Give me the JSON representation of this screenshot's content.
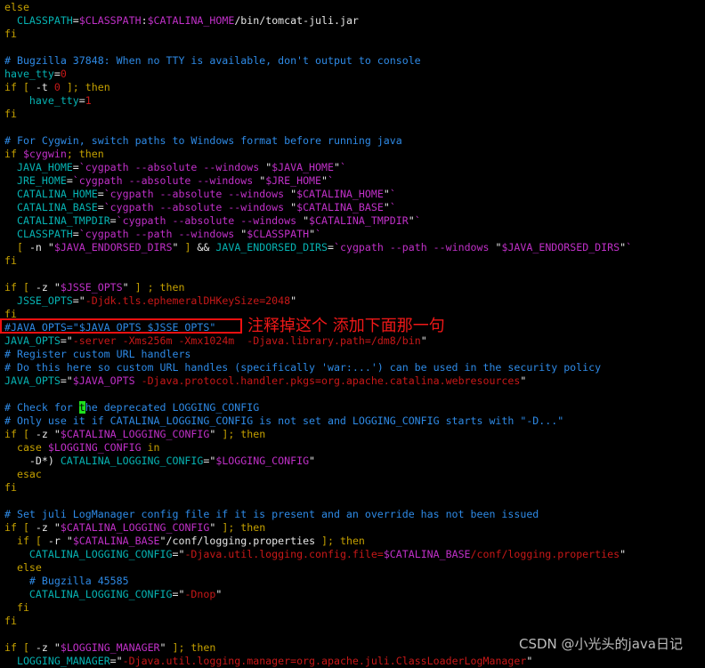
{
  "colors": {
    "keyword": "#c4a000",
    "variable": "#06b3b3",
    "expansion": "#c030c8",
    "string": "#c81818",
    "comment": "#2e8ae6",
    "cursor": "#1ee01e",
    "annotation": "#f01010"
  },
  "annotation": {
    "text": "注释掉这个 添加下面那一句"
  },
  "watermark": "CSDN @小光头的java日记",
  "lines": [
    [
      [
        "k",
        "else"
      ]
    ],
    [
      [
        "n",
        "  "
      ],
      [
        "v",
        "CLASSPATH"
      ],
      [
        "n",
        "="
      ],
      [
        "d",
        "$CLASSPATH"
      ],
      [
        "n",
        ":"
      ],
      [
        "d",
        "$CATALINA_HOME"
      ],
      [
        "n",
        "/bin/tomcat-juli.jar"
      ]
    ],
    [
      [
        "k",
        "fi"
      ]
    ],
    [],
    [
      [
        "c",
        "# Bugzilla 37848: When no TTY is available, don't output to console"
      ]
    ],
    [
      [
        "v",
        "have_tty"
      ],
      [
        "n",
        "="
      ],
      [
        "s",
        "0"
      ]
    ],
    [
      [
        "k",
        "if [ "
      ],
      [
        "n",
        "-t "
      ],
      [
        "s",
        "0"
      ],
      [
        "k",
        " ]; then"
      ]
    ],
    [
      [
        "n",
        "    "
      ],
      [
        "v",
        "have_tty"
      ],
      [
        "n",
        "="
      ],
      [
        "s",
        "1"
      ]
    ],
    [
      [
        "k",
        "fi"
      ]
    ],
    [],
    [
      [
        "c",
        "# For Cygwin, switch paths to Windows format before running java"
      ]
    ],
    [
      [
        "k",
        "if "
      ],
      [
        "d",
        "$cygwin"
      ],
      [
        "k",
        "; then"
      ]
    ],
    [
      [
        "n",
        "  "
      ],
      [
        "v",
        "JAVA_HOME"
      ],
      [
        "n",
        "="
      ],
      [
        "d",
        "`cygpath --absolute --windows "
      ],
      [
        "n",
        "\""
      ],
      [
        "d",
        "$JAVA_HOME"
      ],
      [
        "n",
        "\""
      ],
      [
        "d",
        "`"
      ]
    ],
    [
      [
        "n",
        "  "
      ],
      [
        "v",
        "JRE_HOME"
      ],
      [
        "n",
        "="
      ],
      [
        "d",
        "`cygpath --absolute --windows "
      ],
      [
        "n",
        "\""
      ],
      [
        "d",
        "$JRE_HOME"
      ],
      [
        "n",
        "\""
      ],
      [
        "d",
        "`"
      ]
    ],
    [
      [
        "n",
        "  "
      ],
      [
        "v",
        "CATALINA_HOME"
      ],
      [
        "n",
        "="
      ],
      [
        "d",
        "`cygpath --absolute --windows "
      ],
      [
        "n",
        "\""
      ],
      [
        "d",
        "$CATALINA_HOME"
      ],
      [
        "n",
        "\""
      ],
      [
        "d",
        "`"
      ]
    ],
    [
      [
        "n",
        "  "
      ],
      [
        "v",
        "CATALINA_BASE"
      ],
      [
        "n",
        "="
      ],
      [
        "d",
        "`cygpath --absolute --windows "
      ],
      [
        "n",
        "\""
      ],
      [
        "d",
        "$CATALINA_BASE"
      ],
      [
        "n",
        "\""
      ],
      [
        "d",
        "`"
      ]
    ],
    [
      [
        "n",
        "  "
      ],
      [
        "v",
        "CATALINA_TMPDIR"
      ],
      [
        "n",
        "="
      ],
      [
        "d",
        "`cygpath --absolute --windows "
      ],
      [
        "n",
        "\""
      ],
      [
        "d",
        "$CATALINA_TMPDIR"
      ],
      [
        "n",
        "\""
      ],
      [
        "d",
        "`"
      ]
    ],
    [
      [
        "n",
        "  "
      ],
      [
        "v",
        "CLASSPATH"
      ],
      [
        "n",
        "="
      ],
      [
        "d",
        "`cygpath --path --windows "
      ],
      [
        "n",
        "\""
      ],
      [
        "d",
        "$CLASSPATH"
      ],
      [
        "n",
        "\""
      ],
      [
        "d",
        "`"
      ]
    ],
    [
      [
        "n",
        "  "
      ],
      [
        "k",
        "[ "
      ],
      [
        "n",
        "-n "
      ],
      [
        "n",
        "\""
      ],
      [
        "d",
        "$JAVA_ENDORSED_DIRS"
      ],
      [
        "n",
        "\""
      ],
      [
        "k",
        " ]"
      ],
      [
        "n",
        " && "
      ],
      [
        "v",
        "JAVA_ENDORSED_DIRS"
      ],
      [
        "n",
        "="
      ],
      [
        "d",
        "`cygpath --path --windows "
      ],
      [
        "n",
        "\""
      ],
      [
        "d",
        "$JAVA_ENDORSED_DIRS"
      ],
      [
        "n",
        "\""
      ],
      [
        "d",
        "`"
      ]
    ],
    [
      [
        "k",
        "fi"
      ]
    ],
    [],
    [
      [
        "k",
        "if [ "
      ],
      [
        "n",
        "-z "
      ],
      [
        "n",
        "\""
      ],
      [
        "d",
        "$JSSE_OPTS"
      ],
      [
        "n",
        "\""
      ],
      [
        "k",
        " ] ; then"
      ]
    ],
    [
      [
        "n",
        "  "
      ],
      [
        "v",
        "JSSE_OPTS"
      ],
      [
        "n",
        "=\""
      ],
      [
        "s",
        "-Djdk.tls.ephemeralDHKeySize=2048"
      ],
      [
        "n",
        "\""
      ]
    ],
    [
      [
        "k",
        "fi"
      ]
    ],
    [
      [
        "c",
        "#JAVA_OPTS=\"$JAVA_OPTS $JSSE_OPTS\""
      ]
    ],
    [
      [
        "v",
        "JAVA_OPTS"
      ],
      [
        "n",
        "=\""
      ],
      [
        "s",
        "-server -Xms256m -Xmx1024m  -Djava.library.path=/dm8/bin"
      ],
      [
        "n",
        "\""
      ]
    ],
    [
      [
        "c",
        "# Register custom URL handlers"
      ]
    ],
    [
      [
        "c",
        "# Do this here so custom URL handles (specifically 'war:...') can be used in the security policy"
      ]
    ],
    [
      [
        "v",
        "JAVA_OPTS"
      ],
      [
        "n",
        "=\""
      ],
      [
        "d",
        "$JAVA_OPTS"
      ],
      [
        "s",
        " -Djava.protocol.handler.pkgs=org.apache.catalina.webresources"
      ],
      [
        "n",
        "\""
      ]
    ],
    [],
    [
      [
        "c",
        "# Check for "
      ],
      [
        "cur",
        "t"
      ],
      [
        "c",
        "he deprecated LOGGING_CONFIG"
      ]
    ],
    [
      [
        "c",
        "# Only use it if CATALINA_LOGGING_CONFIG is not set and LOGGING_CONFIG starts with \"-D...\""
      ]
    ],
    [
      [
        "k",
        "if [ "
      ],
      [
        "n",
        "-z "
      ],
      [
        "n",
        "\""
      ],
      [
        "d",
        "$CATALINA_LOGGING_CONFIG"
      ],
      [
        "n",
        "\""
      ],
      [
        "k",
        " ]; then"
      ]
    ],
    [
      [
        "n",
        "  "
      ],
      [
        "k",
        "case "
      ],
      [
        "d",
        "$LOGGING_CONFIG"
      ],
      [
        "k",
        " in"
      ]
    ],
    [
      [
        "n",
        "    -D*) "
      ],
      [
        "v",
        "CATALINA_LOGGING_CONFIG"
      ],
      [
        "n",
        "=\""
      ],
      [
        "d",
        "$LOGGING_CONFIG"
      ],
      [
        "n",
        "\""
      ]
    ],
    [
      [
        "n",
        "  "
      ],
      [
        "k",
        "esac"
      ]
    ],
    [
      [
        "k",
        "fi"
      ]
    ],
    [],
    [
      [
        "c",
        "# Set juli LogManager config file if it is present and an override has not been issued"
      ]
    ],
    [
      [
        "k",
        "if [ "
      ],
      [
        "n",
        "-z "
      ],
      [
        "n",
        "\""
      ],
      [
        "d",
        "$CATALINA_LOGGING_CONFIG"
      ],
      [
        "n",
        "\""
      ],
      [
        "k",
        " ]; then"
      ]
    ],
    [
      [
        "n",
        "  "
      ],
      [
        "k",
        "if [ "
      ],
      [
        "n",
        "-r "
      ],
      [
        "n",
        "\""
      ],
      [
        "d",
        "$CATALINA_BASE"
      ],
      [
        "n",
        "\"/conf/logging.properties"
      ],
      [
        "k",
        " ]; then"
      ]
    ],
    [
      [
        "n",
        "    "
      ],
      [
        "v",
        "CATALINA_LOGGING_CONFIG"
      ],
      [
        "n",
        "=\""
      ],
      [
        "s",
        "-Djava.util.logging.config.file="
      ],
      [
        "d",
        "$CATALINA_BASE"
      ],
      [
        "s",
        "/conf/logging.properties"
      ],
      [
        "n",
        "\""
      ]
    ],
    [
      [
        "n",
        "  "
      ],
      [
        "k",
        "else"
      ]
    ],
    [
      [
        "n",
        "    "
      ],
      [
        "c",
        "# Bugzilla 45585"
      ]
    ],
    [
      [
        "n",
        "    "
      ],
      [
        "v",
        "CATALINA_LOGGING_CONFIG"
      ],
      [
        "n",
        "=\""
      ],
      [
        "s",
        "-Dnop"
      ],
      [
        "n",
        "\""
      ]
    ],
    [
      [
        "n",
        "  "
      ],
      [
        "k",
        "fi"
      ]
    ],
    [
      [
        "k",
        "fi"
      ]
    ],
    [],
    [
      [
        "k",
        "if [ "
      ],
      [
        "n",
        "-z "
      ],
      [
        "n",
        "\""
      ],
      [
        "d",
        "$LOGGING_MANAGER"
      ],
      [
        "n",
        "\""
      ],
      [
        "k",
        " ]; then"
      ]
    ],
    [
      [
        "n",
        "  "
      ],
      [
        "v",
        "LOGGING_MANAGER"
      ],
      [
        "n",
        "=\""
      ],
      [
        "s",
        "-Djava.util.logging.manager=org.apache.juli.ClassLoaderLogManager"
      ],
      [
        "n",
        "\""
      ]
    ]
  ]
}
